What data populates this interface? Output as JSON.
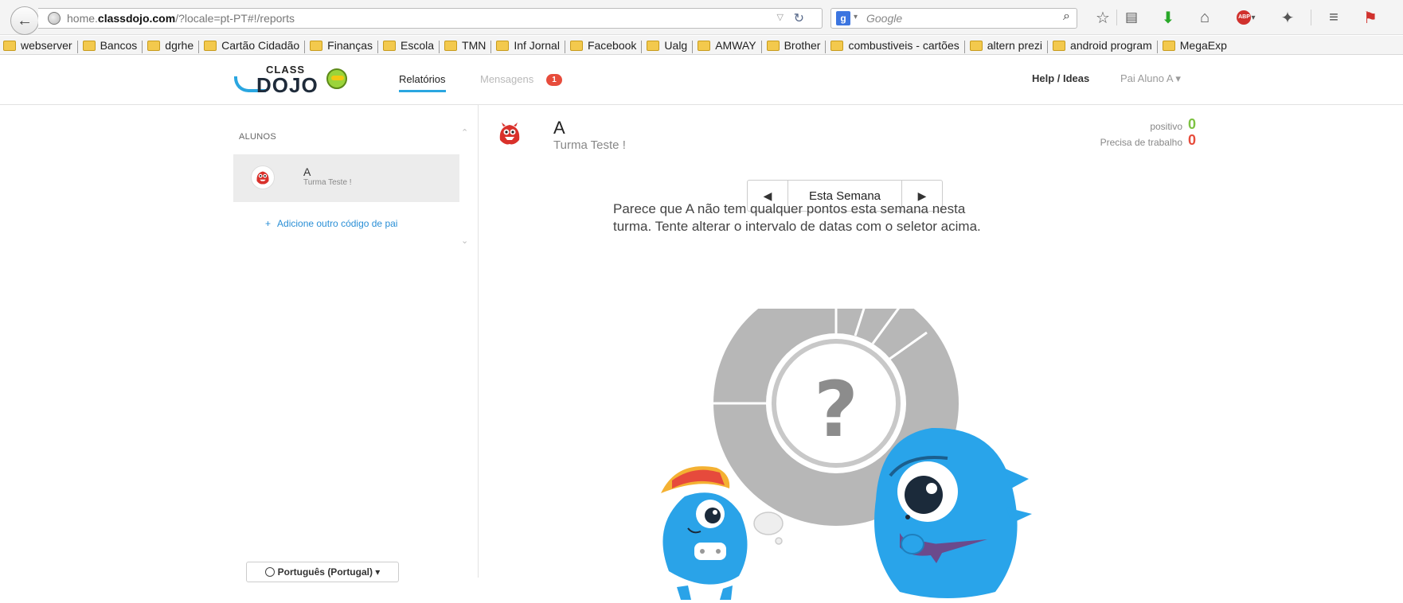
{
  "browser": {
    "url_host_prefix": "home.",
    "url_host_domain": "classdojo.com",
    "url_path": "/?locale=pt-PT#!/reports",
    "search_placeholder": "Google",
    "toolbar_icons": [
      "bookmark-star-icon",
      "reading-list-icon",
      "download-icon",
      "home-icon",
      "adblock-icon",
      "addons-icon",
      "menu-icon",
      "kaspersky-icon"
    ]
  },
  "bookmarks": [
    "webserver",
    "Bancos",
    "dgrhe",
    "Cartão Cidadão",
    "Finanças",
    "Escola",
    "TMN",
    "Inf Jornal",
    "Facebook",
    "Ualg",
    "AMWAY",
    "Brother",
    "combustiveis - cartões",
    "altern prezi",
    "android program",
    "MegaExp"
  ],
  "header": {
    "logo_top": "CLASS",
    "logo_bottom": "DOJO",
    "nav_reports": "Relatórios",
    "nav_messages": "Mensagens",
    "messages_count": "1",
    "help": "Help / Ideas",
    "user_menu": "Pai Aluno A ▾"
  },
  "sidebar": {
    "heading": "ALUNOS",
    "students": [
      {
        "name": "A",
        "class": "Turma Teste !"
      }
    ],
    "add_code": "Adicione outro código de pai",
    "add_code_icon": "+"
  },
  "footer": {
    "language": "Português (Portugal) ▾"
  },
  "report": {
    "student_name": "A",
    "student_class": "Turma Teste !",
    "positive_label": "positivo",
    "positive_value": "0",
    "needs_work_label": "Precisa de trabalho",
    "needs_work_value": "0",
    "week_prev": "◀",
    "week_label": "Esta Semana",
    "week_next": "▶",
    "empty_line1": "Parece que A não tem qualquer pontos esta semana nesta",
    "empty_line2": "turma. Tente alterar o intervalo de datas com o seletor acima.",
    "empty_chart_symbol": "?"
  },
  "colors": {
    "accent": "#2aa6e0",
    "positive": "#7dc242",
    "negative": "#e74c3c",
    "badge": "#e74c3c"
  }
}
